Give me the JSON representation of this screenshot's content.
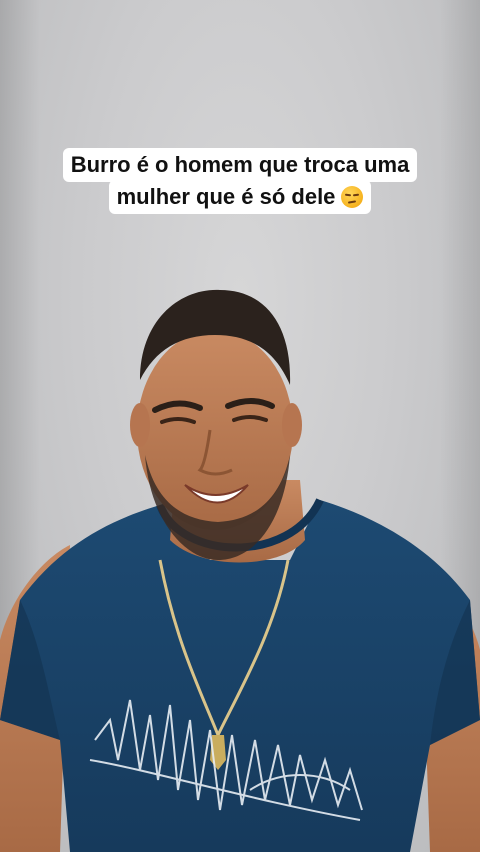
{
  "caption": {
    "line1": "Burro é o homem que troca uma",
    "line2": "mulher que é só dele",
    "emoji_icon": "unamused-face-emoji"
  }
}
